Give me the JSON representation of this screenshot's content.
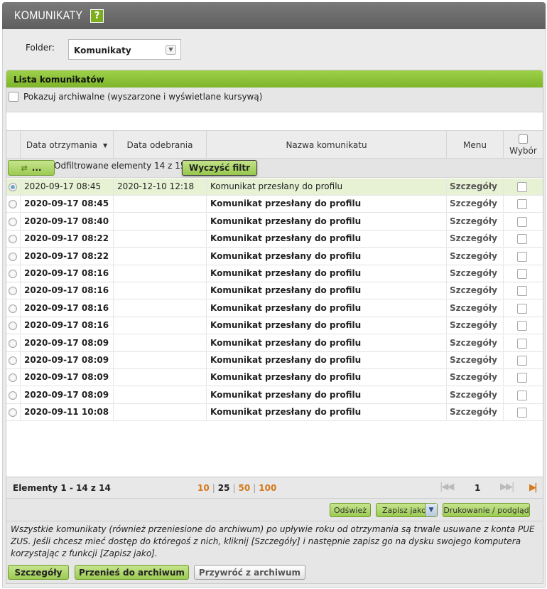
{
  "title": "KOMUNIKATY",
  "help_label": "?",
  "folder": {
    "label": "Folder:",
    "value": "Komunikaty"
  },
  "panel_title": "Lista komunikatów",
  "archive_toggle": "Pokazuj archiwalne (wyszarzone i wyświetlane kursywą)",
  "columns": {
    "received": "Data otrzymania",
    "collected": "Data odebrania",
    "name": "Nazwa komunikatu",
    "menu": "Menu",
    "select": "Wybór"
  },
  "filter": {
    "button_label": "...",
    "status": "Odfiltrowane elementy 14 z 15.",
    "clear_label": "Wyczyść filtr"
  },
  "rows": [
    {
      "received": "2020-09-17 08:45",
      "collected": "2020-12-10 12:18",
      "name": "Komunikat przesłany do profilu",
      "menu": "Szczegóły",
      "unread": false,
      "selected": true
    },
    {
      "received": "2020-09-17 08:45",
      "collected": "",
      "name": "Komunikat przesłany do profilu",
      "menu": "Szczegóły",
      "unread": true,
      "selected": false
    },
    {
      "received": "2020-09-17 08:40",
      "collected": "",
      "name": "Komunikat przesłany do profilu",
      "menu": "Szczegóły",
      "unread": true,
      "selected": false
    },
    {
      "received": "2020-09-17 08:22",
      "collected": "",
      "name": "Komunikat przesłany do profilu",
      "menu": "Szczegóły",
      "unread": true,
      "selected": false
    },
    {
      "received": "2020-09-17 08:22",
      "collected": "",
      "name": "Komunikat przesłany do profilu",
      "menu": "Szczegóły",
      "unread": true,
      "selected": false
    },
    {
      "received": "2020-09-17 08:16",
      "collected": "",
      "name": "Komunikat przesłany do profilu",
      "menu": "Szczegóły",
      "unread": true,
      "selected": false
    },
    {
      "received": "2020-09-17 08:16",
      "collected": "",
      "name": "Komunikat przesłany do profilu",
      "menu": "Szczegóły",
      "unread": true,
      "selected": false
    },
    {
      "received": "2020-09-17 08:16",
      "collected": "",
      "name": "Komunikat przesłany do profilu",
      "menu": "Szczegóły",
      "unread": true,
      "selected": false
    },
    {
      "received": "2020-09-17 08:16",
      "collected": "",
      "name": "Komunikat przesłany do profilu",
      "menu": "Szczegóły",
      "unread": true,
      "selected": false
    },
    {
      "received": "2020-09-17 08:09",
      "collected": "",
      "name": "Komunikat przesłany do profilu",
      "menu": "Szczegóły",
      "unread": true,
      "selected": false
    },
    {
      "received": "2020-09-17 08:09",
      "collected": "",
      "name": "Komunikat przesłany do profilu",
      "menu": "Szczegóły",
      "unread": true,
      "selected": false
    },
    {
      "received": "2020-09-17 08:09",
      "collected": "",
      "name": "Komunikat przesłany do profilu",
      "menu": "Szczegóły",
      "unread": true,
      "selected": false
    },
    {
      "received": "2020-09-17 08:09",
      "collected": "",
      "name": "Komunikat przesłany do profilu",
      "menu": "Szczegóły",
      "unread": true,
      "selected": false
    },
    {
      "received": "2020-09-11 10:08",
      "collected": "",
      "name": "Komunikat przesłany do profilu",
      "menu": "Szczegóły",
      "unread": true,
      "selected": false
    }
  ],
  "pager": {
    "count": "Elementy 1 - 14 z 14",
    "sizes": [
      "10",
      "25",
      "50",
      "100"
    ],
    "active_size": "25",
    "page": "1"
  },
  "actions": {
    "refresh": "Odśwież",
    "save_as": "Zapisz jako",
    "print": "Drukowanie / podgląd"
  },
  "info_text": "Wszystkie komunikaty (również przeniesione do archiwum) po upływie roku od otrzymania są trwale usuwane z konta PUE ZUS. Jeśli chcesz mieć dostęp do któregoś z nich, kliknij [Szczegóły] i następnie zapisz go na dysku swojego komputera korzystając z funkcji [Zapisz jako].",
  "bottom_buttons": {
    "details": "Szczegóły",
    "move_archive": "Przenieś do archiwum",
    "restore_archive": "Przywróć z archiwum"
  }
}
